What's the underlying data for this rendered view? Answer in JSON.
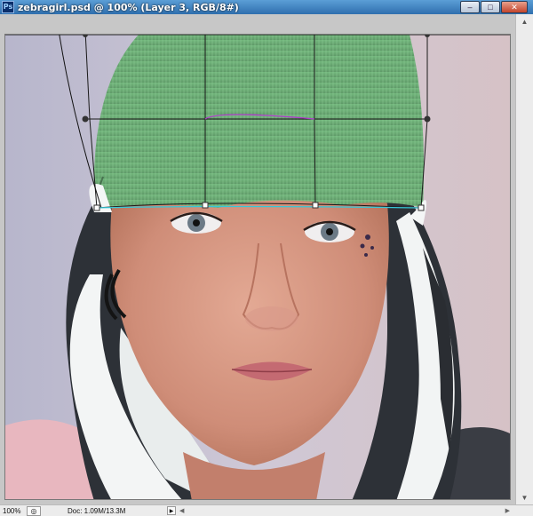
{
  "window": {
    "app_icon_label": "Ps",
    "title": "zebragirl.psd @ 100% (Layer 3, RGB/8#)",
    "controls": {
      "minimize": "–",
      "maximize": "□",
      "close": "✕"
    }
  },
  "status": {
    "zoom": "100%",
    "doc_info": "Doc: 1.09M/13.3M",
    "menu_arrow": "▶"
  },
  "scroll": {
    "up": "▲",
    "down": "▼",
    "left": "◀",
    "right": "▶"
  },
  "colors": {
    "hat": "#6fb27a",
    "skin": "#d89a86",
    "hair_dark": "#2b2f35",
    "hair_light": "#f4f6f6",
    "title_bar": "#2f6fae"
  }
}
